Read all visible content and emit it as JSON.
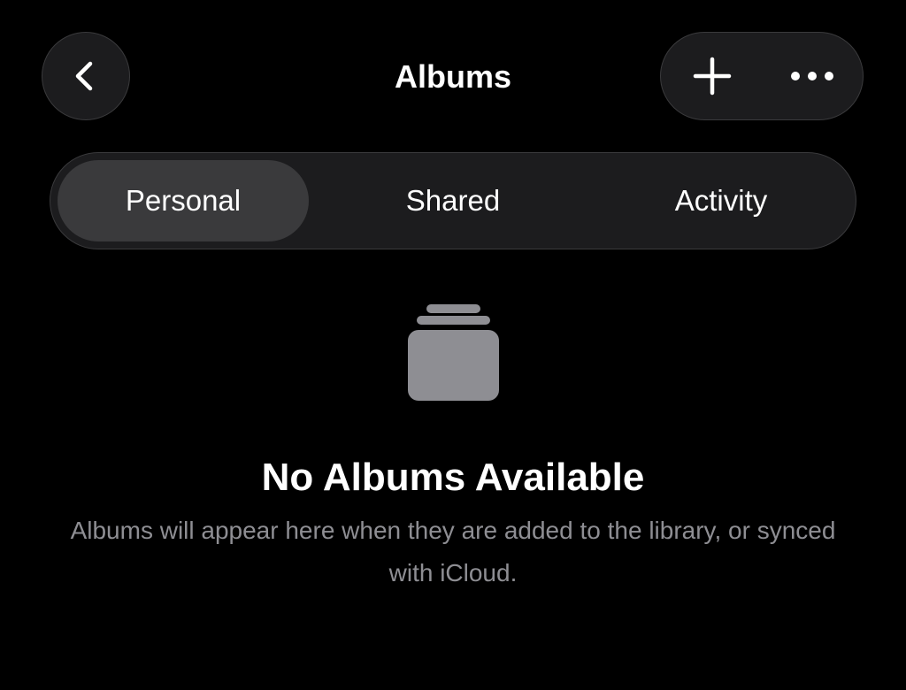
{
  "header": {
    "title": "Albums",
    "back_icon": "chevron-left-icon",
    "add_icon": "plus-icon",
    "more_icon": "ellipsis-icon"
  },
  "segmented_control": {
    "selected": "Personal",
    "segments": [
      {
        "label": "Personal"
      },
      {
        "label": "Shared"
      },
      {
        "label": "Activity"
      }
    ]
  },
  "empty_state": {
    "icon": "albums-stack-icon",
    "title": "No Albums Available",
    "message": "Albums will appear here when they are added to the library, or synced with iCloud."
  },
  "colors": {
    "background": "#000000",
    "control_fill": "#1c1c1e",
    "control_border": "#3a3a3c",
    "selected_segment": "#3a3a3c",
    "icon_gray": "#8e8e93",
    "secondary_text": "#8e8e93"
  }
}
